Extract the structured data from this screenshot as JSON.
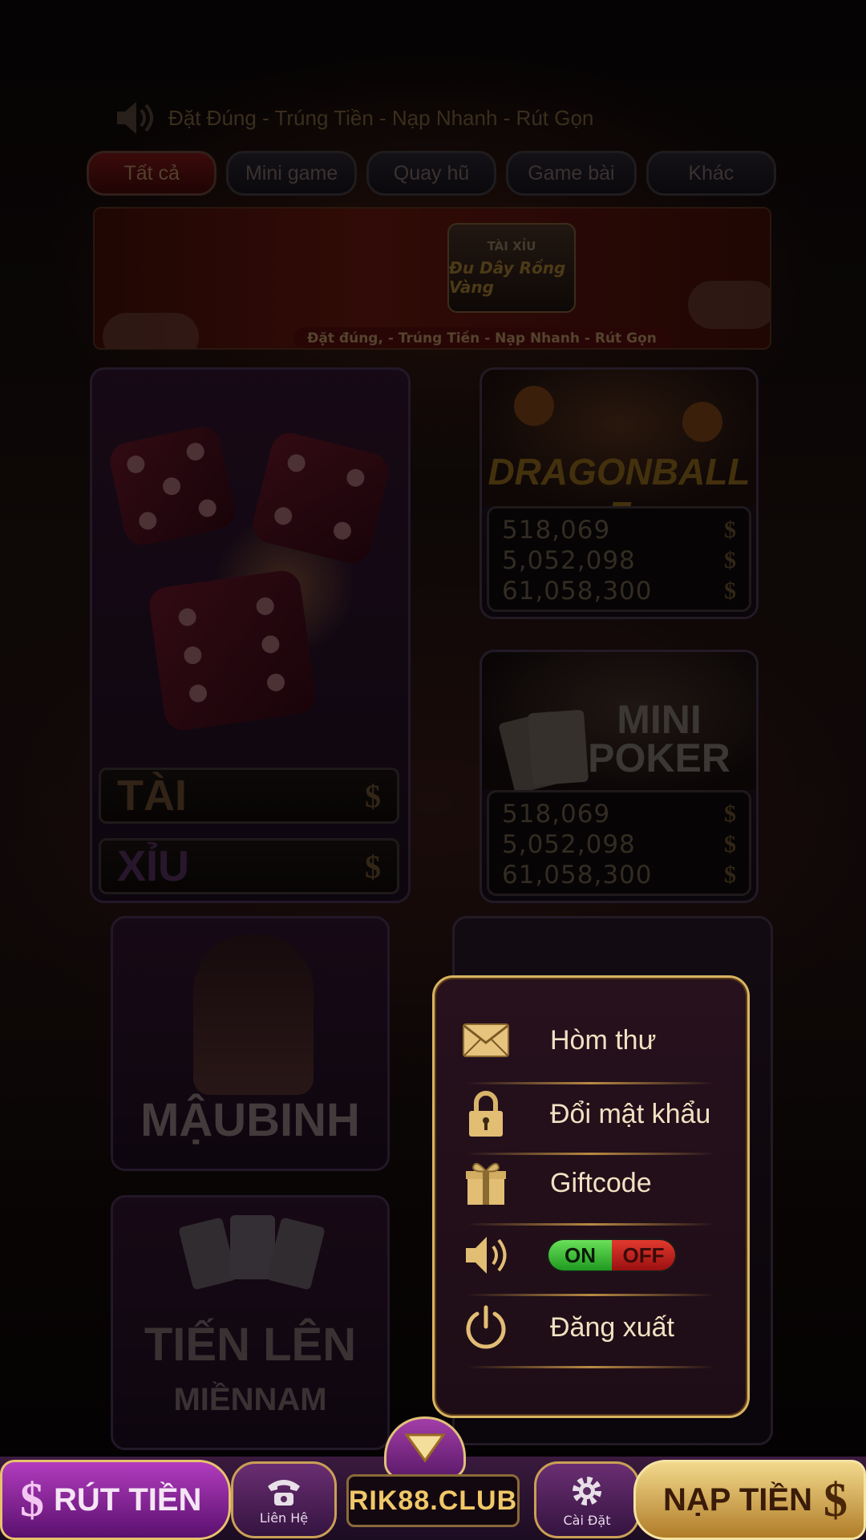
{
  "marquee": {
    "text": "Đặt Đúng  - Trúng Tiền - Nạp Nhanh - Rút Gọn"
  },
  "tabs": [
    {
      "label": "Tất cả",
      "active": true
    },
    {
      "label": "Mini game",
      "active": false
    },
    {
      "label": "Quay hũ",
      "active": false
    },
    {
      "label": "Game bài",
      "active": false
    },
    {
      "label": "Khác",
      "active": false
    }
  ],
  "banner": {
    "logo_line1": "TÀI  XỈU",
    "logo_line2": "Đu Dây Rồng Vàng",
    "caption": "Đặt đúng, - Trúng Tiền - Nạp Nhanh - Rút Gọn"
  },
  "games": {
    "taixiu": {
      "tai_label": "TÀI",
      "xiu_label": "XỈU"
    },
    "dragonball": {
      "title": "DRAGONBALL Z",
      "jackpots": [
        "518,069",
        "5,052,098",
        "61,058,300"
      ]
    },
    "minipoker": {
      "title": "MINI POKER",
      "jackpots": [
        "518,069",
        "5,052,098",
        "61,058,300"
      ]
    },
    "maubinh": {
      "title": "MẬUBINH"
    },
    "tienlen": {
      "title": "TIẾN LÊN",
      "subtitle": "MIỀNNAM"
    }
  },
  "menu": {
    "items": [
      {
        "label": "Hòm thư",
        "icon": "mail-icon"
      },
      {
        "label": "Đổi mật khẩu",
        "icon": "lock-icon"
      },
      {
        "label": "Giftcode",
        "icon": "gift-icon"
      },
      {
        "label": "",
        "icon": "speaker-icon"
      },
      {
        "label": "Đăng xuất",
        "icon": "power-icon"
      }
    ],
    "sound_toggle": {
      "on_label": "ON",
      "off_label": "OFF",
      "state": "on"
    }
  },
  "bottom": {
    "withdraw_label": "RÚT TIỀN",
    "contact_label": "Liên Hệ",
    "brand": "RIK88.CLUB",
    "settings_label": "Cài Đặt",
    "deposit_label": "NẠP TIỀN",
    "currency_symbol": "$"
  },
  "colors": {
    "accent_gold": "#d9b461",
    "toggle_on": "#2fbf2a",
    "toggle_off": "#c8201a"
  }
}
